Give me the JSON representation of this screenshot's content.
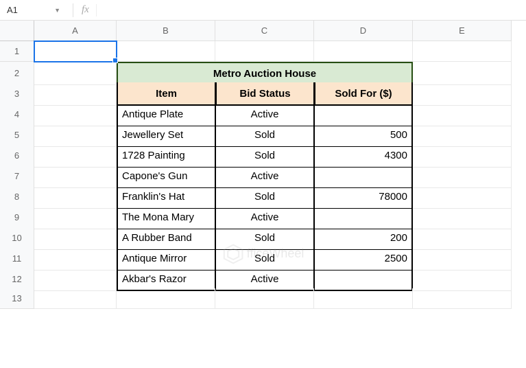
{
  "nameBox": "A1",
  "fx": "fx",
  "formulaValue": "",
  "columns": [
    "A",
    "B",
    "C",
    "D",
    "E"
  ],
  "rows": [
    "1",
    "2",
    "3",
    "4",
    "5",
    "6",
    "7",
    "8",
    "9",
    "10",
    "11",
    "12",
    "13"
  ],
  "title": "Metro Auction House",
  "headers": {
    "item": "Item",
    "status": "Bid Status",
    "sold": "Sold For ($)"
  },
  "data": [
    {
      "item": "Antique Plate",
      "status": "Active",
      "sold": ""
    },
    {
      "item": "Jewellery Set",
      "status": "Sold",
      "sold": "500"
    },
    {
      "item": "1728 Painting",
      "status": "Sold",
      "sold": "4300"
    },
    {
      "item": "Capone's Gun",
      "status": "Active",
      "sold": ""
    },
    {
      "item": "Franklin's Hat",
      "status": "Sold",
      "sold": "78000"
    },
    {
      "item": "The Mona Mary",
      "status": "Active",
      "sold": ""
    },
    {
      "item": "A Rubber Band",
      "status": "Sold",
      "sold": "200"
    },
    {
      "item": "Antique Mirror",
      "status": "Sold",
      "sold": "2500"
    },
    {
      "item": "Akbar's Razor",
      "status": "Active",
      "sold": ""
    }
  ],
  "watermark": "fficeWheel",
  "chart_data": {
    "type": "table",
    "title": "Metro Auction House",
    "columns": [
      "Item",
      "Bid Status",
      "Sold For ($)"
    ],
    "rows": [
      [
        "Antique Plate",
        "Active",
        null
      ],
      [
        "Jewellery Set",
        "Sold",
        500
      ],
      [
        "1728 Painting",
        "Sold",
        4300
      ],
      [
        "Capone's Gun",
        "Active",
        null
      ],
      [
        "Franklin's Hat",
        "Sold",
        78000
      ],
      [
        "The Mona Mary",
        "Active",
        null
      ],
      [
        "A Rubber Band",
        "Sold",
        200
      ],
      [
        "Antique Mirror",
        "Sold",
        2500
      ],
      [
        "Akbar's Razor",
        "Active",
        null
      ]
    ]
  }
}
